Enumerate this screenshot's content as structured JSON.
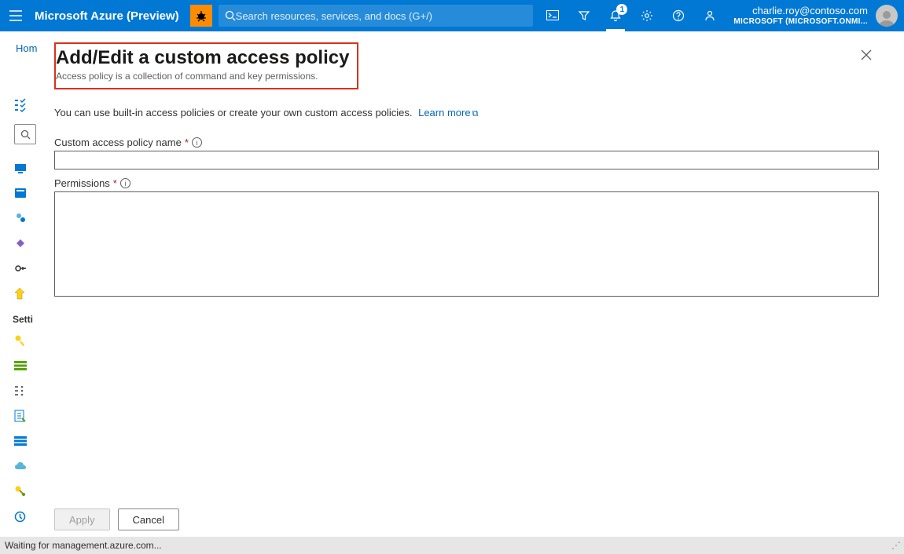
{
  "header": {
    "brand": "Microsoft Azure (Preview)",
    "search_placeholder": "Search resources, services, and docs (G+/)",
    "notification_count": "1",
    "account_email": "charlie.roy@contoso.com",
    "account_tenant": "MICROSOFT (MICROSOFT.ONMI..."
  },
  "breadcrumb": {
    "home": "Hom"
  },
  "sidebar": {
    "section_label": "Setti"
  },
  "blade": {
    "title": "Add/Edit a custom access policy",
    "subtitle": "Access policy is a collection of command and key permissions.",
    "lead_text": "You can use built-in access policies or create your own custom access policies.",
    "learn_more": "Learn more",
    "field_name_label": "Custom access policy name",
    "field_name_value": "",
    "field_perm_label": "Permissions",
    "field_perm_value": "",
    "apply": "Apply",
    "cancel": "Cancel"
  },
  "status": {
    "text": "Waiting for management.azure.com..."
  }
}
